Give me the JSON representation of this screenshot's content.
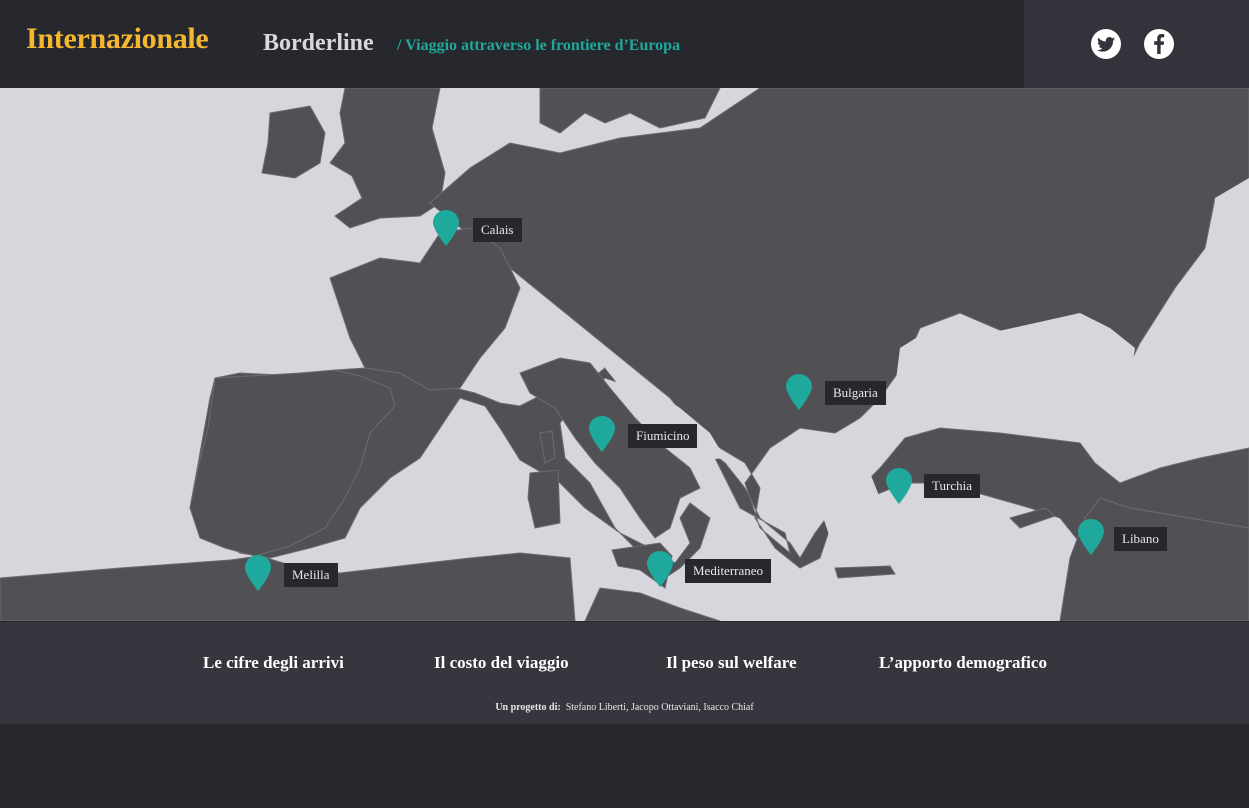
{
  "header": {
    "brand": "Internazionale",
    "title": "Borderline",
    "subtitle": "/ Viaggio attraverso le frontiere d’Europa"
  },
  "social": {
    "twitter_icon": "twitter-icon",
    "facebook_icon": "facebook-icon"
  },
  "map": {
    "land_color": "#515155",
    "sea_color": "#d6d6dc",
    "pin_color": "#1fa89c",
    "locations": [
      {
        "label": "Calais"
      },
      {
        "label": "Bulgaria"
      },
      {
        "label": "Fiumicino"
      },
      {
        "label": "Turchia"
      },
      {
        "label": "Libano"
      },
      {
        "label": "Melilla"
      },
      {
        "label": "Mediterraneo"
      }
    ]
  },
  "nav": {
    "items": [
      {
        "label": "Le cifre degli arrivi"
      },
      {
        "label": "Il costo del viaggio"
      },
      {
        "label": "Il peso sul welfare"
      },
      {
        "label": "L’apporto demografico"
      }
    ]
  },
  "credits": {
    "prefix": "Un progetto di:",
    "authors": "Stefano Liberti, Jacopo Ottaviani, Isacco Chiaf"
  }
}
